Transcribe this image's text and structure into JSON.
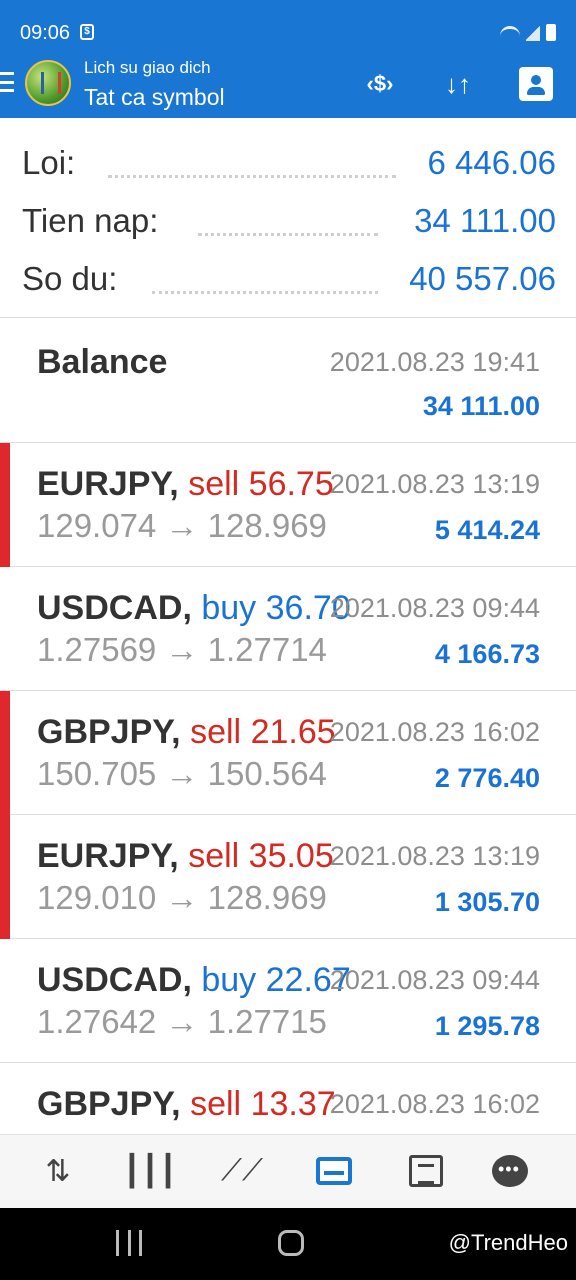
{
  "status_bar": {
    "time": "09:06"
  },
  "app_bar": {
    "subtitle": "Lich su giao dich",
    "title": "Tat ca symbol"
  },
  "summary": {
    "profit_label": "Loi:",
    "profit_value": "6 446.06",
    "deposit_label": "Tien nap:",
    "deposit_value": "34 111.00",
    "balance_label": "So du:",
    "balance_value": "40 557.06"
  },
  "deals": [
    {
      "symbol": "Balance",
      "type": "",
      "volume": "",
      "time": "2021.08.23 19:41",
      "prices": "",
      "profit": "34 111.00",
      "marker": "none"
    },
    {
      "symbol": "EURJPY,",
      "type": "sell",
      "volume": "56.75",
      "time": "2021.08.23 13:19",
      "prices": "129.074 → 128.969",
      "profit": "5 414.24",
      "marker": "red"
    },
    {
      "symbol": "USDCAD,",
      "type": "buy",
      "volume": "36.70",
      "time": "2021.08.23 09:44",
      "prices": "1.27569 → 1.27714",
      "profit": "4 166.73",
      "marker": "none"
    },
    {
      "symbol": "GBPJPY,",
      "type": "sell",
      "volume": "21.65",
      "time": "2021.08.23 16:02",
      "prices": "150.705 → 150.564",
      "profit": "2 776.40",
      "marker": "red"
    },
    {
      "symbol": "EURJPY,",
      "type": "sell",
      "volume": "35.05",
      "time": "2021.08.23 13:19",
      "prices": "129.010 → 128.969",
      "profit": "1 305.70",
      "marker": "red"
    },
    {
      "symbol": "USDCAD,",
      "type": "buy",
      "volume": "22.67",
      "time": "2021.08.23 09:44",
      "prices": "1.27642 → 1.27715",
      "profit": "1 295.78",
      "marker": "none"
    },
    {
      "symbol": "GBPJPY,",
      "type": "sell",
      "volume": "13.37",
      "time": "2021.08.23 16:02",
      "prices": "",
      "profit": "",
      "marker": "none"
    }
  ],
  "bottom_nav": {
    "icons": [
      "quotes-icon",
      "chart-icon",
      "trade-icon",
      "history-icon",
      "news-icon",
      "chat-icon"
    ],
    "active": "history-icon"
  },
  "watermark": "@TrendHeo",
  "colors": {
    "app_bar": "#1976d2",
    "accent_blue": "#1a73d4",
    "sell_red": "#d42a22",
    "marker_red": "#e0282c"
  }
}
